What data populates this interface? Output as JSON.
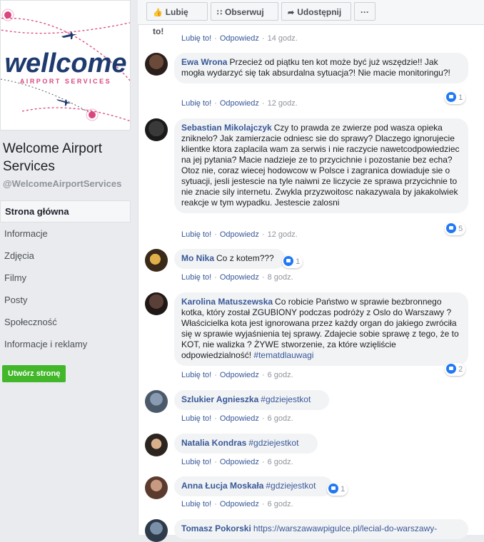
{
  "page": {
    "name": "Welcome Airport Services",
    "handle": "@WelcomeAirportServices",
    "logo_text": "wellcome",
    "logo_sub": "AIRPORT SERVICES"
  },
  "nav": [
    {
      "label": "Strona główna",
      "active": true
    },
    {
      "label": "Informacje"
    },
    {
      "label": "Zdjęcia"
    },
    {
      "label": "Filmy"
    },
    {
      "label": "Posty"
    },
    {
      "label": "Społeczność"
    },
    {
      "label": "Informacje i reklamy"
    }
  ],
  "create_page_label": "Utwórz stronę",
  "action_bar": {
    "like": "Lubię to!",
    "follow": "Obserwuj",
    "share": "Udostępnij",
    "more": "···"
  },
  "common": {
    "like": "Lubię to!",
    "reply": "Odpowiedz",
    "sep": "·"
  },
  "top_meta": {
    "time": "14 godz."
  },
  "comments": [
    {
      "author": "Ewa Wrona",
      "text": "Przecież od piątku ten kot może być już wszędzie!! Jak mogła wydarzyć się tak absurdalna sytuacja?! Nie macie monitoringu?!",
      "time": "12 godz.",
      "reactions": "1"
    },
    {
      "author": "Sebastian Mikolajczyk",
      "text": "Czy to prawda ze zwierze pod wasza opieka zniknelo? Jak zamierzacie odniesc sie do sprawy? Dlaczego ignorujecie klientke ktora zaplacila wam za serwis i nie raczycie nawetcodpowiedziec na jej pytania? Macie nadzieje ze to przycichnie i pozostanie bez echa? Otoz nie, coraz wiecej hodowcow w Polsce i zagranica dowiaduje sie o sytuacji, jesli jestescie na tyle naiwni ze liczycie ze sprawa przycichnie to nie znacie sily internetu. Zwykla przyzwoitosc nakazywala by jakakolwiek reakcje w tym wypadku. Jestescie zalosni",
      "time": "12 godz.",
      "reactions": "5"
    },
    {
      "author": "Mo Nika",
      "text": "Co z kotem???",
      "time": "8 godz.",
      "reactions": "1"
    },
    {
      "author": "Karolina Matuszewska",
      "text": "Co robicie Państwo w sprawie bezbronnego kotka, który został ZGUBIONY podczas podróży z Oslo do Warszawy ? Właścicielka kota jest ignorowana przez każdy organ do jakiego zwróciła się w sprawie wyjaśnienia tej sprawy. Zdajecie sobie sprawę z tego, że to KOT, nie walizka ? ŻYWE stworzenie, za które wzięliście odpowiedzialność!",
      "hashtag": "#tematdlauwagi",
      "time": "6 godz.",
      "reactions": "2"
    },
    {
      "author": "Szlukier Agnieszka",
      "hashtag": "#gdziejestkot",
      "time": "6 godz."
    },
    {
      "author": "Natalia Kondras",
      "hashtag": "#gdziejestkot",
      "time": "6 godz."
    },
    {
      "author": "Anna Łucja Moskała",
      "hashtag": "#gdziejestkot",
      "time": "6 godz.",
      "reactions": "1"
    },
    {
      "author": "Tomasz Pokorski",
      "url": "https://warszawawpigulce.pl/lecial-do-warszawy-"
    }
  ],
  "colors": {
    "link": "#385898",
    "like_blue": "#2078f4",
    "create_green": "#42b72a",
    "logo_pink": "#d9467f",
    "logo_navy": "#1e3a6e"
  }
}
